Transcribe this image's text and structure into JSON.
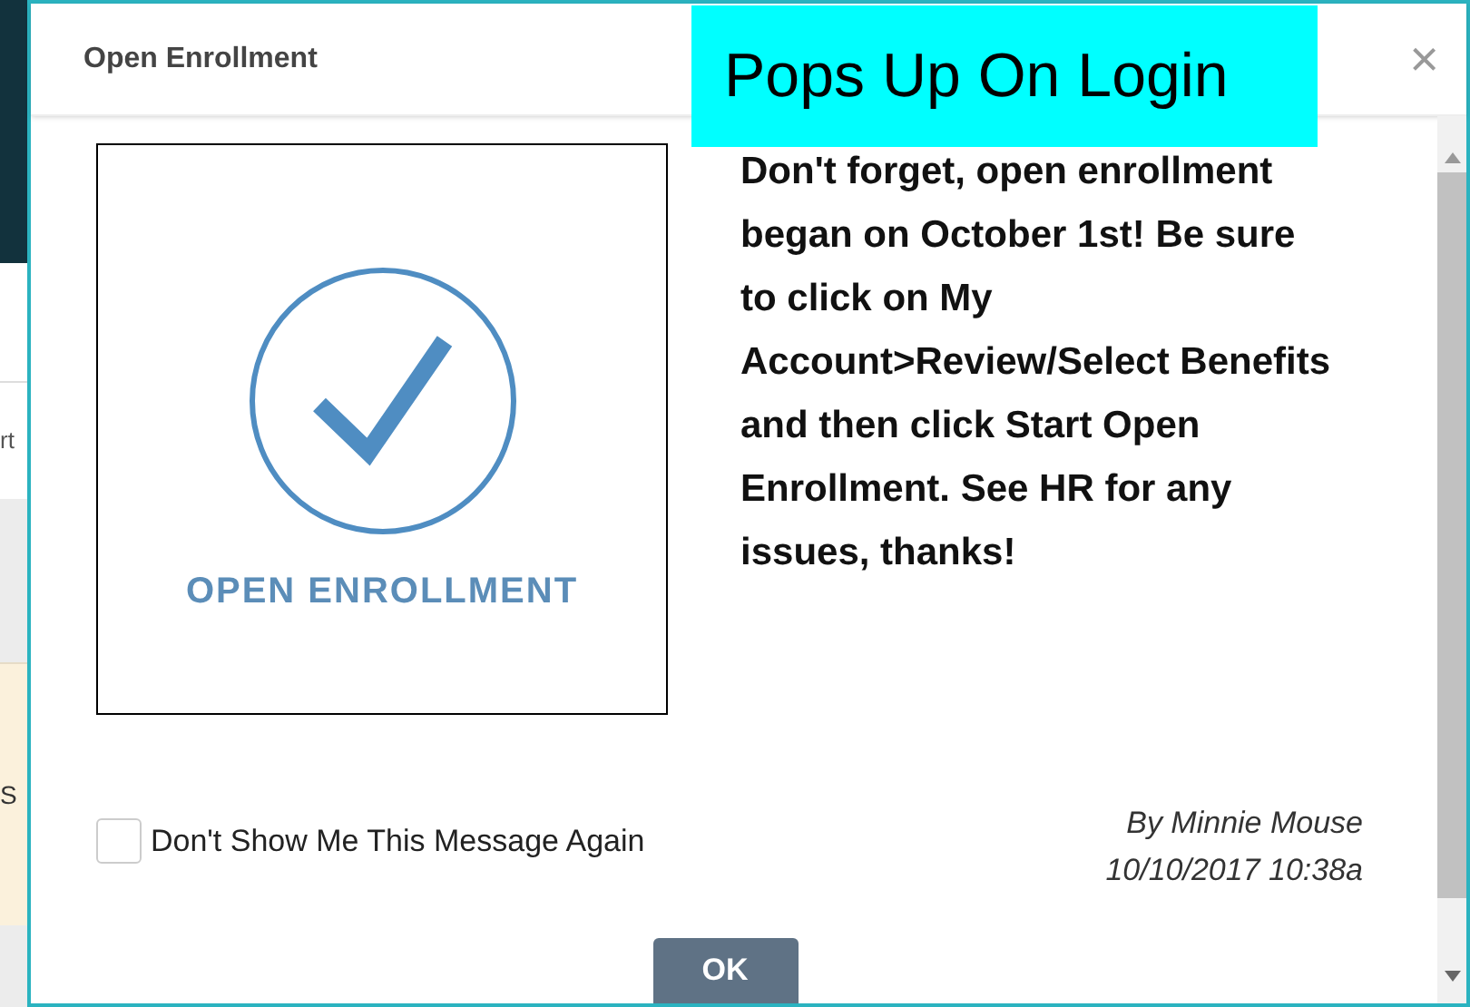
{
  "background": {
    "fragments": [
      "rt",
      "S"
    ]
  },
  "dialog": {
    "title": "Open Enrollment",
    "close": "×",
    "image_caption": "OPEN ENROLLMENT",
    "message": "Don't forget, open enrollment began on October 1st! Be sure to click on My Account>Review/Select Benefits and then click Start Open Enrollment. See HR for any issues, thanks!",
    "dont_show": {
      "label": "Don't Show Me This Message Again",
      "checked": false
    },
    "author": "By Minnie Mouse",
    "timestamp": "10/10/2017 10:38a",
    "ok_button": "OK"
  },
  "callout": {
    "text": "Pops Up On Login"
  }
}
